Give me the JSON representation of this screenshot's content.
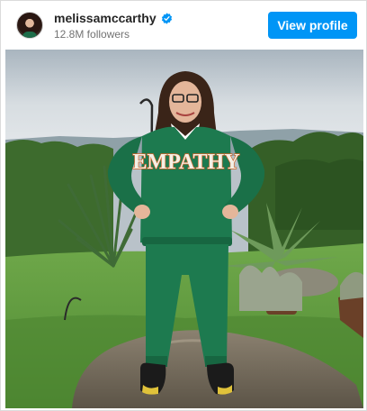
{
  "post": {
    "username": "melissamccarthy",
    "followers": "12.8M followers",
    "view_profile_label": "View profile",
    "verified": true
  },
  "photo": {
    "sweatshirt_text": "EMPATHY",
    "colors": {
      "tracksuit": "#1d7a4f",
      "lettering": "#f3f0e6",
      "lettering_outline": "#d2652b",
      "sky": "#cfd6db",
      "grass": "#5f9a3f"
    }
  },
  "icons": {
    "verified": "verified-badge-icon",
    "avatar": "profile-avatar"
  },
  "colors": {
    "accent": "#0095f6",
    "secondary_text": "#737373"
  }
}
